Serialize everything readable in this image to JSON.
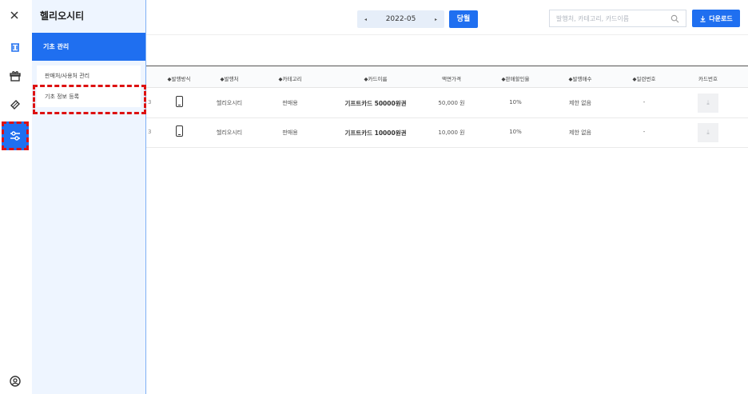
{
  "drawer": {
    "title": "헬리오시티",
    "section": "기초 관리",
    "items": [
      {
        "label": "판매처/사용처 관리"
      },
      {
        "label": "기초 정보 등록"
      }
    ]
  },
  "header": {
    "month": "2022-05",
    "prev_arrow": "◂",
    "next_arrow": "▸",
    "today_label": "당월",
    "search_placeholder": "발행처, 카테고리, 카드이름",
    "download_label": "다운로드"
  },
  "table": {
    "columns": [
      {
        "label": "◆발행방식"
      },
      {
        "label": "◆발행처"
      },
      {
        "label": "◆카테고리"
      },
      {
        "label": "◆카드이름"
      },
      {
        "label": "액면가격"
      },
      {
        "label": "◆판매할인율"
      },
      {
        "label": "◆발행매수"
      },
      {
        "label": "◆일련번호"
      },
      {
        "label": "카드번호"
      }
    ],
    "rows": [
      {
        "edge": "3",
        "publisher": "헬리오시티",
        "category": "판매용",
        "name": "기프트카드 50000원권",
        "price": "50,000 원",
        "discount": "10%",
        "count": "제한 없음",
        "serial": "-"
      },
      {
        "edge": "3",
        "publisher": "헬리오시티",
        "category": "판매용",
        "name": "기프트카드 10000원권",
        "price": "10,000 원",
        "discount": "10%",
        "count": "제한 없음",
        "serial": "-"
      }
    ]
  },
  "icons": {
    "close": "close-icon",
    "rail": [
      "flask-icon",
      "gift-icon",
      "tag-icon",
      "sliders-icon",
      "user-circle-icon"
    ],
    "search": "search-icon",
    "download": "download-icon",
    "phone": "mobile-icon"
  },
  "colors": {
    "accent": "#1f6ff0",
    "highlight": "#dd1111",
    "drawer_bg": "#eef5ff"
  }
}
